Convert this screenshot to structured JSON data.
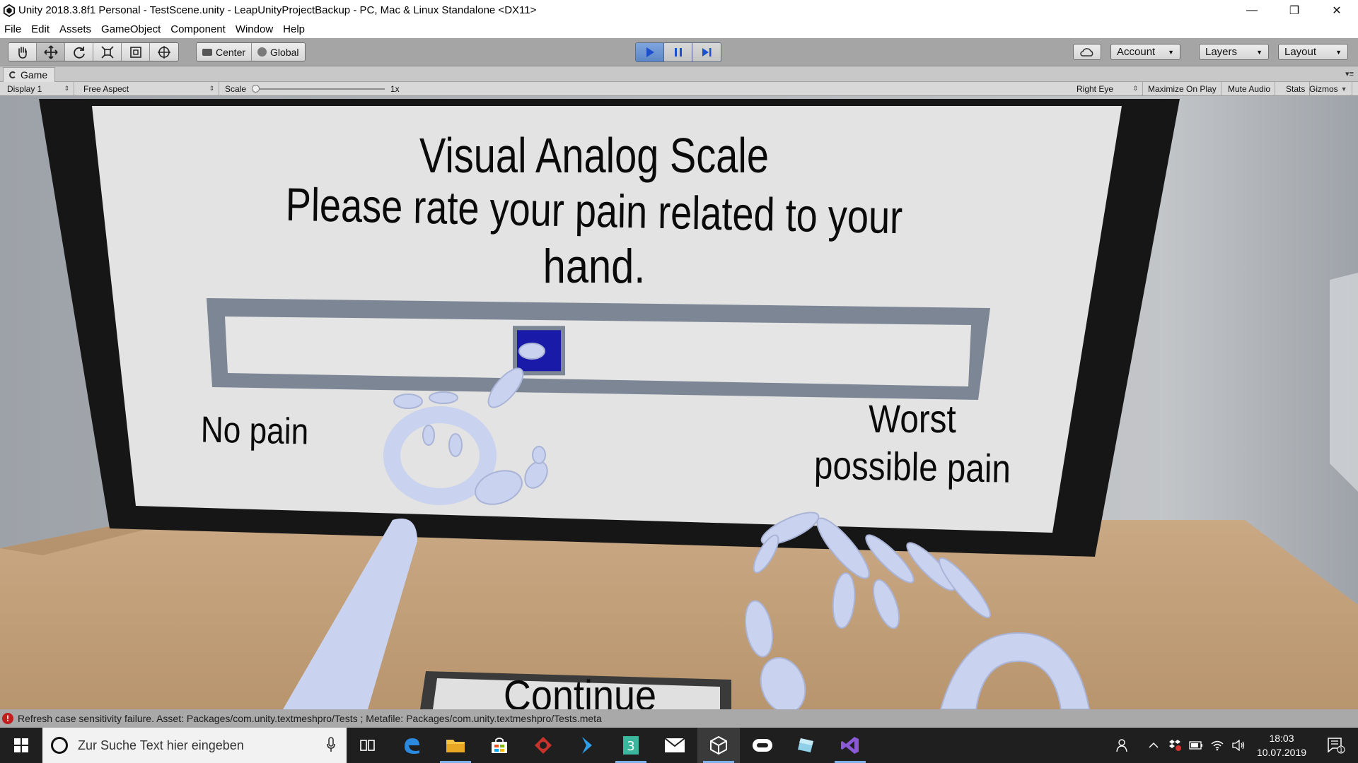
{
  "titlebar": {
    "title": "Unity 2018.3.8f1 Personal - TestScene.unity - LeapUnityProjectBackup - PC, Mac & Linux Standalone <DX11>",
    "minimize": "—",
    "maximize": "❐",
    "close": "✕"
  },
  "menubar": {
    "items": [
      "File",
      "Edit",
      "Assets",
      "GameObject",
      "Component",
      "Window",
      "Help"
    ]
  },
  "toolbar": {
    "tools": [
      "hand-tool",
      "move-tool",
      "rotate-tool",
      "scale-tool",
      "rect-tool",
      "transform-tool"
    ],
    "active_tool": "move-tool",
    "pivot_mode": "Center",
    "pivot_rotation": "Global",
    "play_state": "playing",
    "account_label": "Account",
    "layers_label": "Layers",
    "layout_label": "Layout"
  },
  "game_tab": {
    "label": "Game"
  },
  "game_controls": {
    "display": "Display 1",
    "aspect": "Free Aspect",
    "scale_label": "Scale",
    "scale_value": "1x",
    "eye": "Right Eye",
    "maximize_on_play": "Maximize On Play",
    "mute_audio": "Mute Audio",
    "stats": "Stats",
    "gizmos": "Gizmos"
  },
  "scene": {
    "title": "Visual Analog Scale",
    "question_line1": "Please rate your pain related to your",
    "question_line2": "hand.",
    "min_label": "No pain",
    "max_label_line1": "Worst",
    "max_label_line2": "possible pain",
    "continue_label": "Continue",
    "slider_position": 0.42,
    "colors": {
      "panel": "#e3e3e3",
      "frame": "#161616",
      "slider_frame": "#7d8695",
      "handle": "#1a1aa8",
      "hands": "#c9d2ee"
    }
  },
  "statusbar": {
    "message": "Refresh case sensitivity failure. Asset: Packages/com.unity.textmeshpro/Tests ; Metafile: Packages/com.unity.textmeshpro/Tests.meta"
  },
  "taskbar": {
    "search_placeholder": "Zur Suche Text hier eingeben",
    "apps": [
      "task-view",
      "edge",
      "file-explorer",
      "store",
      "app-red",
      "app-blue-arrow",
      "app-green-3",
      "mail",
      "unity",
      "oculus",
      "app-glass",
      "visual-studio"
    ],
    "time": "18:03",
    "date": "10.07.2019",
    "notification_count": "1"
  }
}
